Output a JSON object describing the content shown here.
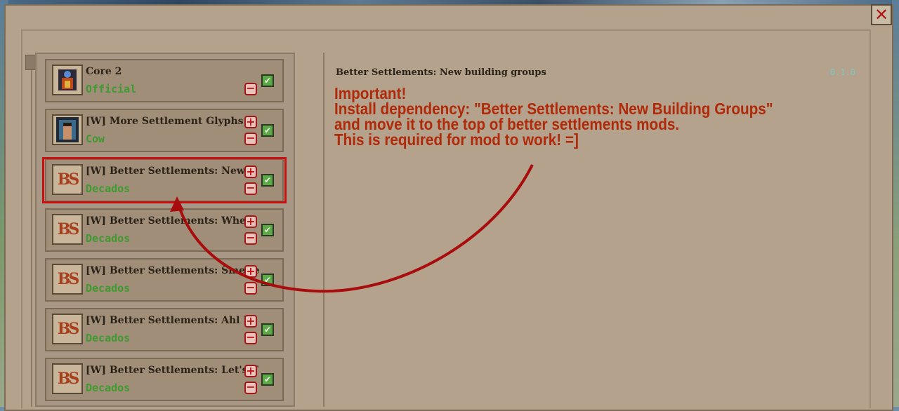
{
  "window": {
    "close_label": "✕"
  },
  "mods": [
    {
      "title": "Core 2",
      "author": "Official",
      "thumb": "core-icon",
      "has_add": false
    },
    {
      "title": "[W] More Settlement Glyphs",
      "author": "Cow",
      "thumb": "portrait-icon",
      "has_add": true
    },
    {
      "title": "[W] Better Settlements: New b",
      "author": "Decados",
      "thumb": "bs-logo-icon",
      "has_add": true,
      "selected": true
    },
    {
      "title": "[W] Better Settlements: Wheat",
      "author": "Decados",
      "thumb": "bs-logo-icon",
      "has_add": true
    },
    {
      "title": "[W] Better Settlements: Smelte",
      "author": "Decados",
      "thumb": "bs-logo-icon",
      "has_add": true
    },
    {
      "title": "[W] Better Settlements: Ahl Fr",
      "author": "Decados",
      "thumb": "bs-logo-icon",
      "has_add": true
    },
    {
      "title": "[W] Better Settlements: Let's T",
      "author": "Decados",
      "thumb": "bs-logo-icon",
      "has_add": true
    }
  ],
  "bs_logo_text": "BS",
  "detail": {
    "title": "Better Settlements: New building groups",
    "version": "0.1.0"
  },
  "annotation": {
    "line1": "Important!",
    "line2": "Install dependency: \"Better Settlements: New Building Groups\"",
    "line3": "and move it to the top of better settlements mods.",
    "line4": "This is required for mod to work! =]"
  },
  "colors": {
    "accent": "#c81010",
    "author": "#3f9a30",
    "annotation": "#b02a0a",
    "panel": "#b5a28c"
  }
}
